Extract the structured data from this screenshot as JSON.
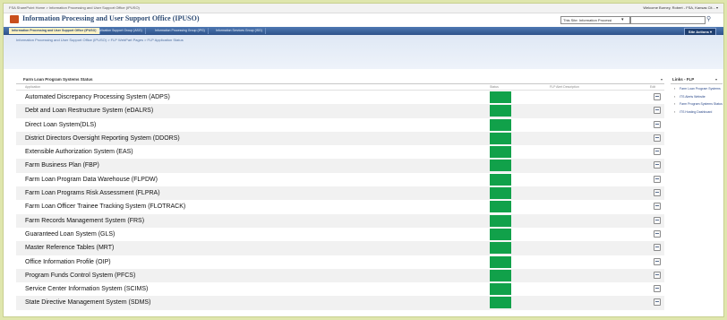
{
  "topbar": {
    "breadcrumb": "FSA SharePoint Home > Information Processing and User Support Office (IPUSO)",
    "welcome": "Welcome Burney, Robert - FSA, Kansas Cit... ▾"
  },
  "site": {
    "title": "Information Processing and User Support Office (IPUSO)",
    "search_scope": "This Site: Information Processi",
    "search_scope_arrow": "▾",
    "search_go_glyph": "⚲"
  },
  "nav": {
    "tabs": [
      {
        "label": "Information Processing and User Support Office (IPUSO)",
        "active": true
      },
      {
        "label": "Application Support Group (ASG)",
        "active": false
      },
      {
        "label": "Information Processing Group (IPG)",
        "active": false
      },
      {
        "label": "Information Services Group (ISG)",
        "active": false
      }
    ],
    "site_actions": "Site Actions ▾"
  },
  "breadcrumb": "Information Processing and User Support Office (IPUSO) > FLP WebPart Pages > FLP Application Status",
  "status_webpart": {
    "title": "Farm Loan Program Systems Status",
    "menu_arrow": "▾",
    "columns": {
      "application": "Application",
      "status": "Status",
      "last_mod": "FLP Alert Description",
      "edit": "Edit"
    },
    "status_color": "#11a14a",
    "rows": [
      "Automated Discrepancy Processing System (ADPS)",
      "Debt and Loan Restructure System (eDALRS)",
      "Direct Loan System(DLS)",
      "District Directors Oversight Reporting System (DDORS)",
      "Extensible Authorization System (EAS)",
      "Farm Business Plan (FBP)",
      "Farm Loan Program Data Warehouse (FLPDW)",
      "Farm Loan Programs Risk Assessment (FLPRA)",
      "Farm Loan Officer Trainee Tracking System (FLOTRACK)",
      "Farm Records Management System (FRS)",
      "Guaranteed Loan System (GLS)",
      "Master Reference Tables (MRT)",
      "Office Information Profile (OIP)",
      "Program Funds Control System (PFCS)",
      "Service Center Information System (SCIMS)",
      "State Directive Management System (SDMS)"
    ]
  },
  "links_webpart": {
    "title": "Links - FLP",
    "menu_arrow": "▾",
    "bullet": "▪",
    "items": [
      "Farm Loan Program Systems",
      "ITS Alerts Website",
      "Farm Program Systems Status",
      "ITS Hosting Dashboard"
    ]
  }
}
